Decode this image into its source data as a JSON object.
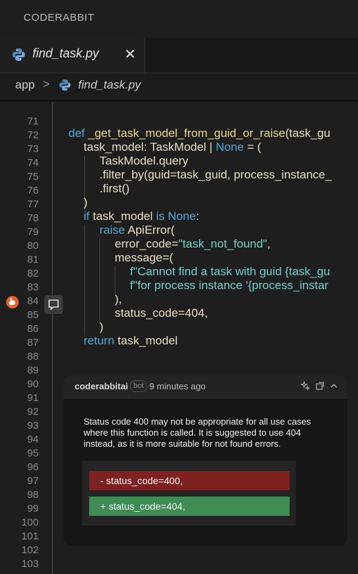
{
  "app": {
    "title": "CODERABBIT"
  },
  "tab": {
    "label": "find_task.py",
    "close": "✕",
    "icon": "python-icon"
  },
  "breadcrumb": {
    "folder": "app",
    "separator": ">",
    "file": "find_task.py",
    "icon": "python-icon"
  },
  "line_numbers": [
    "71",
    "72",
    "73",
    "74",
    "75",
    "76",
    "77",
    "78",
    "79",
    "80",
    "81",
    "82",
    "83",
    "84",
    "85",
    "86",
    "87",
    "88",
    "89",
    "90",
    "91",
    "92",
    "93",
    "94",
    "95",
    "96",
    "97",
    "98",
    "99",
    "100",
    "101",
    "102",
    "103"
  ],
  "code": {
    "l72": {
      "kw": "def ",
      "name": "_get_task_model_from_guid_or_raise",
      "args": "(task_gu"
    },
    "l73": {
      "a": "task_model: TaskModel | ",
      "none": "None",
      "b": " = ("
    },
    "l74": "TaskModel.query",
    "l75": ".filter_by(guid=task_guid, process_instance_",
    "l76": ".first()",
    "l77": ")",
    "l78": {
      "if": "if ",
      "var": "task_model ",
      "is": "is ",
      "none": "None",
      "colon": ":"
    },
    "l79": {
      "raise": "raise ",
      "err": "ApiError("
    },
    "l80": {
      "a": "error_code=",
      "str": "\"task_not_found\"",
      "b": ","
    },
    "l81": "message=(",
    "l82": "f\"Cannot find a task with guid {task_gu",
    "l83": "f\"for process instance '{process_instar",
    "l84": "),",
    "l85": "status_code=404,",
    "l86": ")",
    "l87": {
      "ret": "return ",
      "val": "task_model"
    }
  },
  "review": {
    "author": "coderabbitai",
    "badge": "bot",
    "time": "9 minutes ago",
    "body": "Status code 400 may not be appropriate for all use cases where this function is called. It is suggested to use 404 instead, as it is more suitable for not found errors.",
    "removed": "- status_code=400,",
    "added": "+ status_code=404,"
  },
  "colors": {
    "keyword": "#4ea9d6",
    "string": "#6fd3c9",
    "removed": "#7e2121",
    "added": "#3f8d55",
    "rabbit": "#e8632b"
  }
}
